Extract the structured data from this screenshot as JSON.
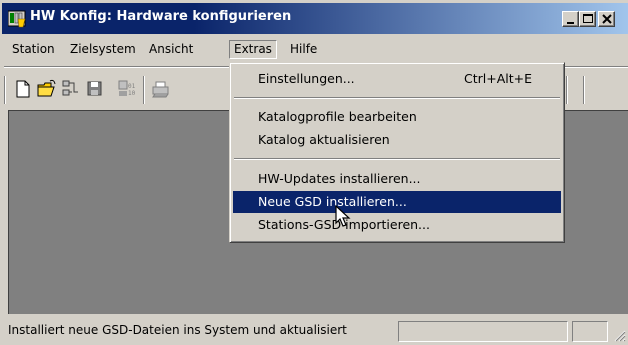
{
  "window": {
    "title": "HW Konfig: Hardware konfigurieren"
  },
  "menubar": {
    "items": [
      "Station",
      "Zielsystem",
      "Ansicht",
      "Extras",
      "Hilfe"
    ],
    "open_item": "Extras"
  },
  "toolbar": {
    "buttons": [
      "new-icon",
      "open-icon",
      "network-icon",
      "save-icon",
      "compile-icon",
      "print-icon"
    ]
  },
  "extras_menu": {
    "items": [
      {
        "label": "Einstellungen...",
        "shortcut": "Ctrl+Alt+E"
      },
      {
        "label": "Katalogprofile bearbeiten"
      },
      {
        "label": "Katalog aktualisieren"
      },
      {
        "label": "HW-Updates installieren..."
      },
      {
        "label": "Neue GSD installieren...",
        "highlighted": true
      },
      {
        "label": "Stations-GSD importieren..."
      }
    ]
  },
  "statusbar": {
    "text": "Installiert neue GSD-Dateien ins System und aktualisiert"
  },
  "colors": {
    "titlebar_active": "#0a246a",
    "titlebar_gradient_end": "#a6caf0",
    "highlight": "#0a246a",
    "face": "#d4d0c8",
    "client": "#808080"
  }
}
